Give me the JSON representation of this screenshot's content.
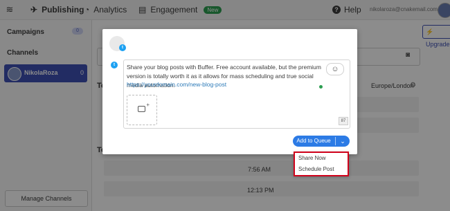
{
  "nav": {
    "publishing": "Publishing",
    "analytics": "Analytics",
    "engagement": "Engagement",
    "new_badge": "New",
    "help": "Help",
    "email": "nikolaroza@cnakemail.com"
  },
  "sidebar": {
    "campaigns_label": "Campaigns",
    "campaigns_count": "0",
    "channels_label": "Channels",
    "account_name": "NikolaRoza",
    "account_count": "0",
    "manage_channels": "Manage Channels"
  },
  "main": {
    "upgrade": "Upgrade",
    "today_title": "To",
    "tomorrow_title": "To",
    "timezone": "Europe/London",
    "times": [
      "7:56 AM",
      "12:13 PM"
    ]
  },
  "composer": {
    "text": "Share your blog posts with Buffer. Free account available, but the premium version is totally worth it as it allows for mass scheduling and true social media automation.",
    "link": "https://yourdomain.com/new-blog-post",
    "char_count": "87",
    "add_to_queue": "Add to Queue"
  },
  "dropdown": {
    "items": [
      "Share Now",
      "Schedule Post"
    ]
  },
  "colors": {
    "primary": "#2c7be5",
    "twitter": "#1da1f2",
    "highlight": "#d0021b",
    "sidebar_active": "#3f51b5"
  }
}
